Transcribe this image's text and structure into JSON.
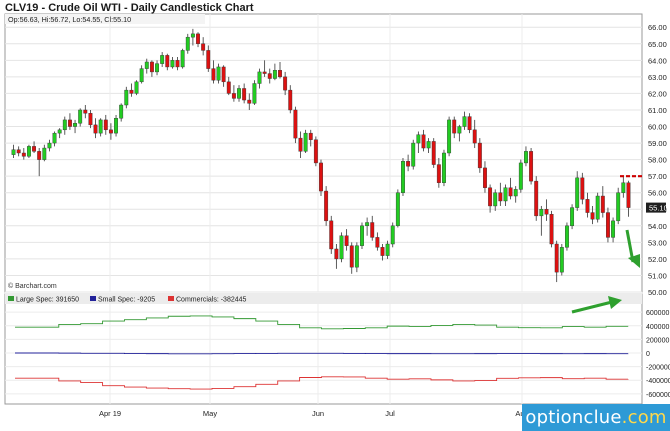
{
  "title": "CLV19 - Crude Oil WTI - Daily Candlestick Chart",
  "ohlc_readout": "Op:56.63, Hi:56.72, Lo:54.55, Cl:55.10",
  "source_credit": "© Barchart.com",
  "watermark": {
    "brand": "optionclue",
    "tld": ".com"
  },
  "colors": {
    "up": "#22cc22",
    "down": "#dd1111",
    "large_spec": "#339933",
    "small_spec": "#222299",
    "commercials": "#dd3333",
    "last_price_bg": "#1f1f1f",
    "level_line": "#cc0000",
    "arrow": "#2ea02e"
  },
  "chart_data": [
    {
      "type": "candlestick",
      "title": "CLV19 - Crude Oil WTI - Daily Candlestick Chart",
      "y_ticks": [
        "66.00",
        "65.00",
        "64.00",
        "63.00",
        "62.00",
        "61.00",
        "60.00",
        "59.00",
        "58.00",
        "57.00",
        "56.00",
        "55.00",
        "54.00",
        "53.00",
        "52.00",
        "51.00",
        "50.00"
      ],
      "ylim": [
        50,
        66.8
      ],
      "grid": true,
      "last_price": "55.10",
      "level": 57.0,
      "x_labels": [
        "Apr 19",
        "May",
        "Jun",
        "Jul",
        "Aug"
      ],
      "candles": [
        [
          58.3,
          58.9,
          58.1,
          58.6
        ],
        [
          58.6,
          58.8,
          58.2,
          58.4
        ],
        [
          58.4,
          58.7,
          58.0,
          58.2
        ],
        [
          58.2,
          58.9,
          58.1,
          58.8
        ],
        [
          58.8,
          59.1,
          58.4,
          58.5
        ],
        [
          58.5,
          58.7,
          57.0,
          58.0
        ],
        [
          58.0,
          58.9,
          57.9,
          58.7
        ],
        [
          58.7,
          59.2,
          58.5,
          59.0
        ],
        [
          59.0,
          59.7,
          58.8,
          59.6
        ],
        [
          59.6,
          59.9,
          59.3,
          59.8
        ],
        [
          59.8,
          60.6,
          59.5,
          60.4
        ],
        [
          60.4,
          60.8,
          59.8,
          60.0
        ],
        [
          60.0,
          60.4,
          59.6,
          60.2
        ],
        [
          60.2,
          61.1,
          60.0,
          61.0
        ],
        [
          61.0,
          61.3,
          60.5,
          60.8
        ],
        [
          60.8,
          61.0,
          59.9,
          60.1
        ],
        [
          60.1,
          60.5,
          59.3,
          59.6
        ],
        [
          59.6,
          60.5,
          59.4,
          60.4
        ],
        [
          60.4,
          60.7,
          59.5,
          59.8
        ],
        [
          59.8,
          60.2,
          59.2,
          59.6
        ],
        [
          59.6,
          60.7,
          59.4,
          60.5
        ],
        [
          60.5,
          61.4,
          60.3,
          61.3
        ],
        [
          61.3,
          62.4,
          61.1,
          62.2
        ],
        [
          62.2,
          62.6,
          61.8,
          62.0
        ],
        [
          62.0,
          62.8,
          61.9,
          62.7
        ],
        [
          62.7,
          63.7,
          62.6,
          63.5
        ],
        [
          63.5,
          64.1,
          63.2,
          63.9
        ],
        [
          63.9,
          64.0,
          63.0,
          63.3
        ],
        [
          63.3,
          64.0,
          63.1,
          63.8
        ],
        [
          63.8,
          64.5,
          63.6,
          64.3
        ],
        [
          64.3,
          64.4,
          63.4,
          63.6
        ],
        [
          63.6,
          64.2,
          63.5,
          64.0
        ],
        [
          64.0,
          64.2,
          63.4,
          63.6
        ],
        [
          63.6,
          64.7,
          63.5,
          64.6
        ],
        [
          64.6,
          65.6,
          64.4,
          65.4
        ],
        [
          65.4,
          65.9,
          64.9,
          65.6
        ],
        [
          65.6,
          65.7,
          64.8,
          65.0
        ],
        [
          65.0,
          65.4,
          64.3,
          64.6
        ],
        [
          64.6,
          64.9,
          63.3,
          63.5
        ],
        [
          63.5,
          64.0,
          62.6,
          62.8
        ],
        [
          62.8,
          63.8,
          62.6,
          63.6
        ],
        [
          63.6,
          63.7,
          62.4,
          62.7
        ],
        [
          62.7,
          63.0,
          61.9,
          62.0
        ],
        [
          62.0,
          62.5,
          61.5,
          61.7
        ],
        [
          61.7,
          62.5,
          61.5,
          62.3
        ],
        [
          62.3,
          62.6,
          61.4,
          61.6
        ],
        [
          61.6,
          62.0,
          61.0,
          61.4
        ],
        [
          61.4,
          62.8,
          61.3,
          62.6
        ],
        [
          62.6,
          63.5,
          62.3,
          63.3
        ],
        [
          63.3,
          64.0,
          63.0,
          63.2
        ],
        [
          63.2,
          63.5,
          62.6,
          62.9
        ],
        [
          62.9,
          63.8,
          62.8,
          63.4
        ],
        [
          63.4,
          63.9,
          62.9,
          63.0
        ],
        [
          63.0,
          63.3,
          61.9,
          62.2
        ],
        [
          62.2,
          62.5,
          60.8,
          61.0
        ],
        [
          61.0,
          61.2,
          59.0,
          59.3
        ],
        [
          59.3,
          59.7,
          58.1,
          58.5
        ],
        [
          58.5,
          59.8,
          58.4,
          59.6
        ],
        [
          59.6,
          59.8,
          58.8,
          59.2
        ],
        [
          59.2,
          59.4,
          57.6,
          57.8
        ],
        [
          57.8,
          58.0,
          55.8,
          56.1
        ],
        [
          56.1,
          56.4,
          54.0,
          54.3
        ],
        [
          54.3,
          54.6,
          52.3,
          52.6
        ],
        [
          52.6,
          52.9,
          51.4,
          52.0
        ],
        [
          52.0,
          53.6,
          51.8,
          53.4
        ],
        [
          53.4,
          53.8,
          52.5,
          52.8
        ],
        [
          52.8,
          53.0,
          51.1,
          51.5
        ],
        [
          51.5,
          53.0,
          51.2,
          52.8
        ],
        [
          52.8,
          54.2,
          52.6,
          54.0
        ],
        [
          54.0,
          54.5,
          53.4,
          54.2
        ],
        [
          54.2,
          54.6,
          53.1,
          53.3
        ],
        [
          53.3,
          53.6,
          52.5,
          52.7
        ],
        [
          52.7,
          52.9,
          51.9,
          52.2
        ],
        [
          52.2,
          53.1,
          52.0,
          52.9
        ],
        [
          52.9,
          54.2,
          52.7,
          54.0
        ],
        [
          54.0,
          56.2,
          53.9,
          56.0
        ],
        [
          56.0,
          58.1,
          55.8,
          57.9
        ],
        [
          57.9,
          58.3,
          57.3,
          57.6
        ],
        [
          57.6,
          59.2,
          57.4,
          59.0
        ],
        [
          59.0,
          59.7,
          58.4,
          59.5
        ],
        [
          59.5,
          59.8,
          58.5,
          58.7
        ],
        [
          58.7,
          59.3,
          58.4,
          59.1
        ],
        [
          59.1,
          59.3,
          57.5,
          57.7
        ],
        [
          57.7,
          58.1,
          56.3,
          56.6
        ],
        [
          56.6,
          58.6,
          56.4,
          58.4
        ],
        [
          58.4,
          60.6,
          58.2,
          60.4
        ],
        [
          60.4,
          60.6,
          59.3,
          59.6
        ],
        [
          59.6,
          60.1,
          59.1,
          60.0
        ],
        [
          60.0,
          60.9,
          59.8,
          60.6
        ],
        [
          60.6,
          60.8,
          59.6,
          59.8
        ],
        [
          59.8,
          60.4,
          58.7,
          59.0
        ],
        [
          59.0,
          59.3,
          57.2,
          57.5
        ],
        [
          57.5,
          57.9,
          56.0,
          56.3
        ],
        [
          56.3,
          56.5,
          54.8,
          55.2
        ],
        [
          55.2,
          56.2,
          54.9,
          56.0
        ],
        [
          56.0,
          56.6,
          55.2,
          55.5
        ],
        [
          55.5,
          56.5,
          55.2,
          56.3
        ],
        [
          56.3,
          56.9,
          55.6,
          55.8
        ],
        [
          55.8,
          56.4,
          55.4,
          56.2
        ],
        [
          56.2,
          58.0,
          56.0,
          57.8
        ],
        [
          57.8,
          58.8,
          57.6,
          58.5
        ],
        [
          58.5,
          58.7,
          56.5,
          56.7
        ],
        [
          56.7,
          57.0,
          54.3,
          54.6
        ],
        [
          54.6,
          55.2,
          53.4,
          55.0
        ],
        [
          55.0,
          55.6,
          54.3,
          54.7
        ],
        [
          54.7,
          54.9,
          52.7,
          52.9
        ],
        [
          52.9,
          53.1,
          50.6,
          51.2
        ],
        [
          51.2,
          52.9,
          51.0,
          52.7
        ],
        [
          52.7,
          54.2,
          52.5,
          54.0
        ],
        [
          54.0,
          55.3,
          53.8,
          55.1
        ],
        [
          55.1,
          57.3,
          54.9,
          56.9
        ],
        [
          56.9,
          57.2,
          55.3,
          55.6
        ],
        [
          55.6,
          56.0,
          54.5,
          54.8
        ],
        [
          54.8,
          55.2,
          54.1,
          54.4
        ],
        [
          54.4,
          56.0,
          54.2,
          55.8
        ],
        [
          55.8,
          56.4,
          54.5,
          54.8
        ],
        [
          54.8,
          55.1,
          53.0,
          53.3
        ],
        [
          53.3,
          54.5,
          53.0,
          54.3
        ],
        [
          54.3,
          56.3,
          54.1,
          56.0
        ],
        [
          56.0,
          57.0,
          55.7,
          56.6
        ],
        [
          56.6,
          56.72,
          54.55,
          55.1
        ]
      ]
    },
    {
      "type": "line",
      "title": "COT",
      "y_ticks": [
        "600000",
        "400000",
        "200000",
        "0",
        "-200000",
        "-400000",
        "-600000"
      ],
      "ylim": [
        -720000,
        720000
      ],
      "series": [
        {
          "name": "Large Spec",
          "last_label": "Large Spec: 391650",
          "values": [
            380000,
            380000,
            420000,
            430000,
            470000,
            490000,
            515000,
            540000,
            545000,
            530000,
            505000,
            470000,
            420000,
            370000,
            355000,
            360000,
            370000,
            395000,
            390000,
            405000,
            420000,
            410000,
            380000,
            372000,
            370000,
            388000,
            380000,
            392000,
            391650
          ]
        },
        {
          "name": "Small Spec",
          "last_label": "Small Spec: -9205",
          "values": [
            0,
            0,
            -2000,
            -5000,
            -5000,
            -8000,
            -9000,
            -12000,
            -12000,
            -10000,
            -8000,
            -6000,
            -5000,
            -4000,
            -4000,
            -6000,
            -8000,
            -9000,
            -9000,
            -10000,
            -10000,
            -9000,
            -8000,
            -8000,
            -9000,
            -10000,
            -9000,
            -9500,
            -9205
          ]
        },
        {
          "name": "Commercials",
          "last_label": "Commercials: -382445",
          "values": [
            -370000,
            -370000,
            -410000,
            -435000,
            -480000,
            -500000,
            -515000,
            -525000,
            -530000,
            -520000,
            -495000,
            -460000,
            -410000,
            -360000,
            -350000,
            -352000,
            -370000,
            -385000,
            -380000,
            -395000,
            -410000,
            -405000,
            -372000,
            -365000,
            -362000,
            -378000,
            -370000,
            -385000,
            -382445
          ]
        }
      ],
      "x_labels": [
        "Apr 19",
        "May",
        "Jun",
        "Jul",
        "Aug"
      ]
    }
  ]
}
